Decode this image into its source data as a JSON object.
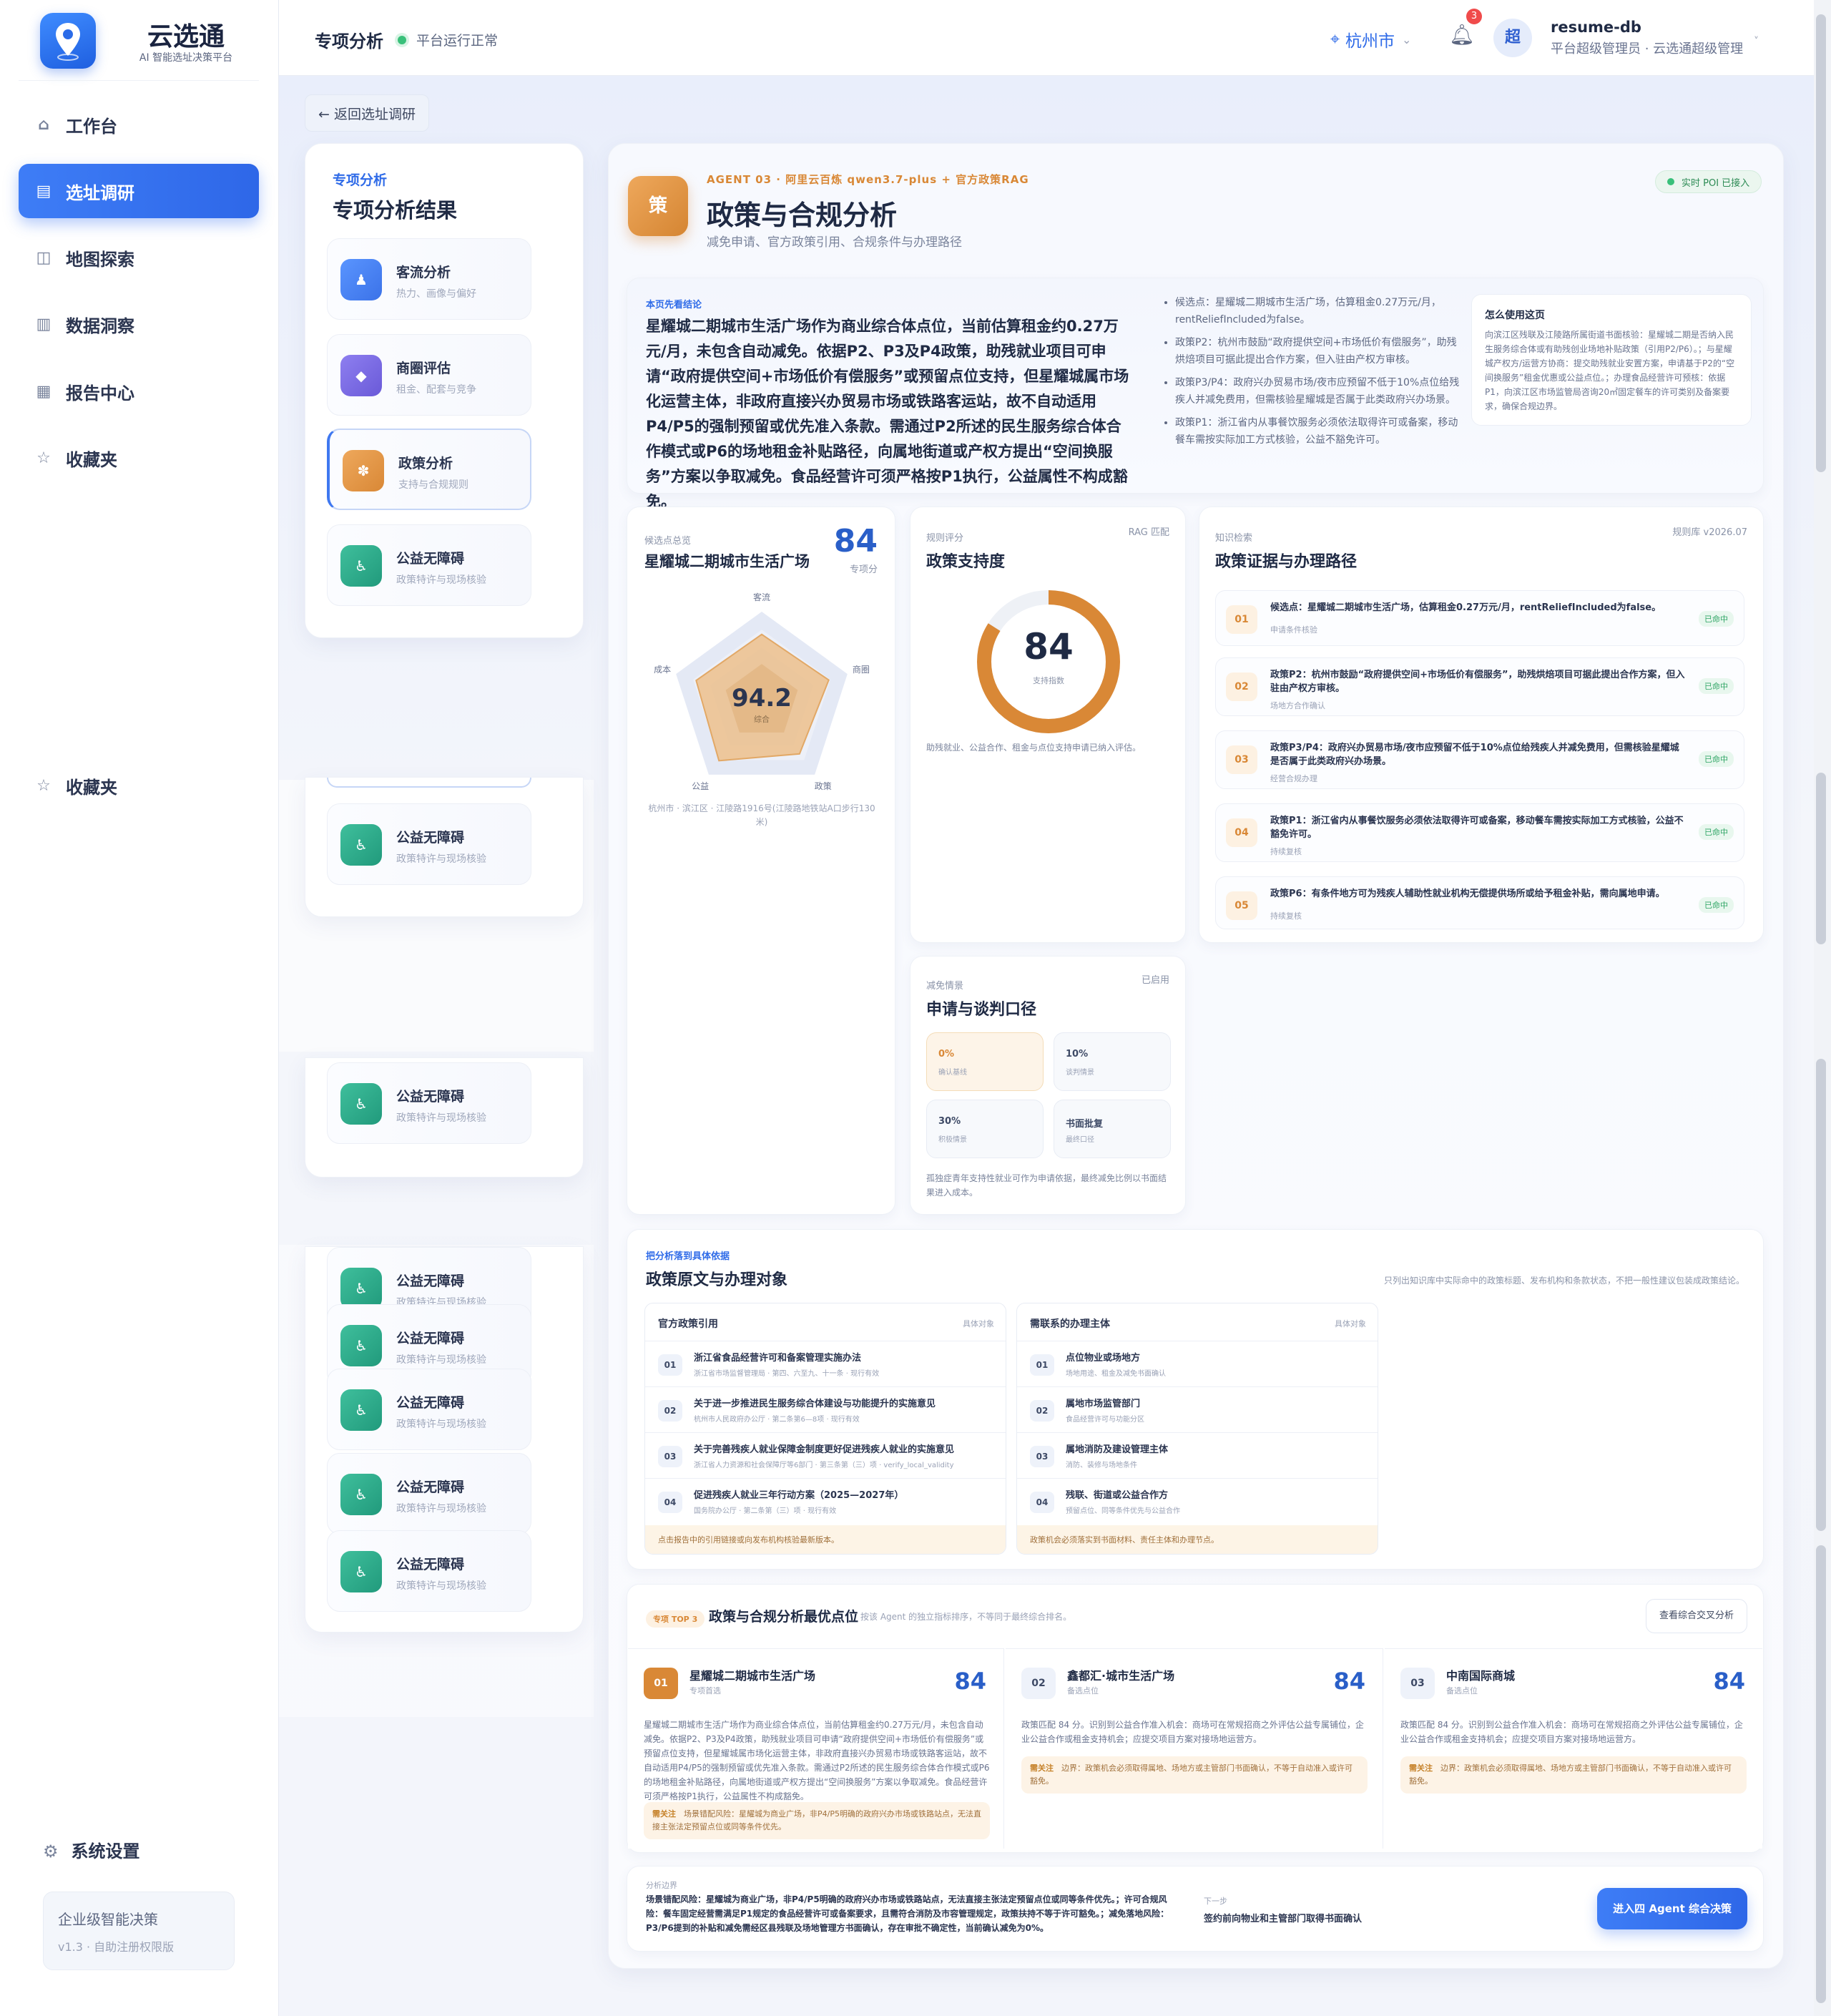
{
  "app": {
    "name": "云选通",
    "tagline": "AI 智能选址决策平台"
  },
  "nav": {
    "items": [
      {
        "label": "工作台",
        "icon": "home-icon"
      },
      {
        "label": "选址调研",
        "icon": "clipboard-icon"
      },
      {
        "label": "地图探索",
        "icon": "map-icon"
      },
      {
        "label": "数据洞察",
        "icon": "chart-icon"
      },
      {
        "label": "报告中心",
        "icon": "report-icon"
      },
      {
        "label": "收藏夹",
        "icon": "star-icon"
      }
    ],
    "dup_fav": "收藏夹",
    "settings": "系统设置",
    "enterprise_title": "企业级智能决策",
    "enterprise_sub": "v1.3 · 自助注册权限版"
  },
  "header": {
    "title": "专项分析",
    "status": "平台运行正常",
    "city": "杭州市",
    "bell_count": "3",
    "avatar": "超",
    "user": "resume-db",
    "role": "平台超级管理员 · 云选通超级管理"
  },
  "back_label": "← 返回选址调研",
  "left_panel": {
    "kicker": "专项分析",
    "title": "专项分析结果",
    "items": [
      {
        "name": "客流分析",
        "desc": "热力、画像与偏好",
        "glyph": "♟"
      },
      {
        "name": "商圈评估",
        "desc": "租金、配套与竞争",
        "glyph": "◆"
      },
      {
        "name": "政策分析",
        "desc": "支持与合规规则",
        "glyph": "✽"
      },
      {
        "name": "公益无障碍",
        "desc": "政策特许与现场核验",
        "glyph": "♿"
      }
    ],
    "ghost_item": {
      "name": "公益无障碍",
      "desc": "政策特许与现场核验"
    }
  },
  "agent": {
    "kicker": "AGENT 03 · 阿里云百炼 qwen3.7-plus + 官方政策RAG",
    "icon_char": "策",
    "title": "政策与合规分析",
    "subtitle": "减免申请、官方政策引用、合规条件与办理路径",
    "poi_badge": "实时 POI 已接入"
  },
  "summary": {
    "kicker": "本页先看结论",
    "text": "星耀城二期城市生活广场作为商业综合体点位，当前估算租金约0.27万元/月，未包含自动减免。依据P2、P3及P4政策，助残就业项目可申请“政府提供空间+市场低价有偿服务”或预留点位支持，但星耀城属市场化运营主体，非政府直接兴办贸易市场或铁路客运站，故不自动适用P4/P5的强制预留或优先准入条款。需通过P2所述的民生服务综合体合作模式或P6的场地租金补贴路径，向属地街道或产权方提出“空间换服务”方案以争取减免。食品经营许可须严格按P1执行，公益属性不构成豁免。",
    "bullets": [
      "候选点：星耀城二期城市生活广场，估算租金0.27万元/月，rentReliefIncluded为false。",
      "政策P2：杭州市鼓励“政府提供空间+市场低价有偿服务”，助残烘焙项目可据此提出合作方案，但入驻由产权方审核。",
      "政策P3/P4：政府兴办贸易市场/夜市应预留不低于10%点位给残疾人并减免费用，但需核验星耀城是否属于此类政府兴办场景。",
      "政策P1：浙江省内从事餐饮服务必须依法取得许可或备案，移动餐车需按实际加工方式核验，公益不豁免许可。"
    ],
    "howto_title": "怎么使用这页",
    "howto_text": "向滨江区残联及江陵路所属街道书面核验：星耀城二期是否纳入民生服务综合体或有助残创业场地补贴政策（引用P2/P6）。；与星耀城产权方/运营方协商：提交助残就业安置方案，申请基于P2的“空间换服务”租金优惠或公益点位。；办理食品经营许可预核：依据P1，向滨江区市场监管局咨询20㎡固定餐车的许可类别及备案要求，确保合规边界。"
  },
  "radar": {
    "kicker": "候选点总览",
    "score": "84",
    "score_label": "专项分",
    "title": "星耀城二期城市生活广场",
    "center_value": "94.2",
    "center_label": "综合",
    "axes": [
      "客流",
      "商圈",
      "政策",
      "公益",
      "成本"
    ],
    "address": "杭州市 · 滨江区 · 江陵路1916号(江陵路地铁站A口步行130米)"
  },
  "chart_data": {
    "type": "radar",
    "categories": [
      "客流",
      "商圈",
      "政策",
      "公益",
      "成本"
    ],
    "series": [
      {
        "values": [
          88,
          92,
          84,
          95,
          90
        ]
      }
    ],
    "center_value": 94.2
  },
  "support": {
    "kicker": "规则评分",
    "tag": "RAG 匹配",
    "title": "政策支持度",
    "score": "84",
    "score_label": "支持指数",
    "progress": 0.84,
    "note": "助残就业、公益合作、租金与点位支持申请已纳入评估。"
  },
  "evidence": {
    "kicker": "知识检索",
    "tag": "规则库 v2026.07",
    "title": "政策证据与办理路径",
    "rows": [
      {
        "num": "01",
        "text": "候选点：星耀城二期城市生活广场，估算租金0.27万元/月，rentReliefIncluded为false。",
        "sub": "申请条件核验",
        "tag": "已命中"
      },
      {
        "num": "02",
        "text": "政策P2：杭州市鼓励“政府提供空间+市场低价有偿服务”，助残烘焙项目可据此提出合作方案，但入驻由产权方审核。",
        "sub": "场地方合作确认",
        "tag": "已命中"
      },
      {
        "num": "03",
        "text": "政策P3/P4：政府兴办贸易市场/夜市应预留不低于10%点位给残疾人并减免费用，但需核验星耀城是否属于此类政府兴办场景。",
        "sub": "经营合规办理",
        "tag": "已命中"
      },
      {
        "num": "04",
        "text": "政策P1：浙江省内从事餐饮服务必须依法取得许可或备案，移动餐车需按实际加工方式核验，公益不豁免许可。",
        "sub": "持续复核",
        "tag": "已命中"
      },
      {
        "num": "05",
        "text": "政策P6：有条件地方可为残疾人辅助性就业机构无偿提供场所或给予租金补贴，需向属地申请。",
        "sub": "持续复核",
        "tag": "已命中"
      }
    ]
  },
  "relief": {
    "kicker": "减免情景",
    "tag": "已启用",
    "title": "申请与谈判口径",
    "cells": [
      {
        "v": "0%",
        "s": "确认基线"
      },
      {
        "v": "10%",
        "s": "谈判情景"
      },
      {
        "v": "30%",
        "s": "积极情景"
      },
      {
        "v": "书面批复",
        "s": "最终口径"
      }
    ],
    "note": "孤独症青年支持性就业可作为申请依据，最终减免比例以书面结果进入成本。"
  },
  "policy": {
    "kicker": "把分析落到具体依据",
    "title": "政策原文与办理对象",
    "note": "只列出知识库中实际命中的政策标题、发布机构和条款状态，不把一般性建议包装成政策结论。",
    "left_header": "官方政策引用",
    "left_tag": "具体对象",
    "left_rows": [
      {
        "n": "01",
        "a": "浙江省食品经营许可和备案管理实施办法",
        "b": "浙江省市场监督管理局 · 第四、六至九、十一条 · 现行有效"
      },
      {
        "n": "02",
        "a": "关于进一步推进民生服务综合体建设与功能提升的实施意见",
        "b": "杭州市人民政府办公厅 · 第二条第6—8项 · 现行有效"
      },
      {
        "n": "03",
        "a": "关于完善残疾人就业保障金制度更好促进残疾人就业的实施意见",
        "b": "浙江省人力资源和社会保障厅等6部门 · 第三条第（三）项 · verify_local_validity"
      },
      {
        "n": "04",
        "a": "促进残疾人就业三年行动方案（2025—2027年）",
        "b": "国务院办公厅 · 第二条第（三）项 · 现行有效"
      }
    ],
    "left_foot": "点击报告中的引用链接或向发布机构核验最新版本。",
    "right_header": "需联系的办理主体",
    "right_tag": "具体对象",
    "right_rows": [
      {
        "n": "01",
        "a": "点位物业或场地方",
        "b": "场地用途、租金及减免书面确认"
      },
      {
        "n": "02",
        "a": "属地市场监管部门",
        "b": "食品经营许可与功能分区"
      },
      {
        "n": "03",
        "a": "属地消防及建设管理主体",
        "b": "消防、装修与场地条件"
      },
      {
        "n": "04",
        "a": "残联、街道或公益合作方",
        "b": "预留点位、同等条件优先与公益合作"
      }
    ],
    "right_foot": "政策机会必须落实到书面材料、责任主体和办理节点。"
  },
  "top3": {
    "badge": "专项 TOP 3",
    "title": "政策与合规分析最优点位",
    "sub": "按该 Agent 的独立指标排序，不等同于最终综合排名。",
    "button": "查看综合交叉分析",
    "cards": [
      {
        "n": "01",
        "name": "星耀城二期城市生活广场",
        "state": "专项首选",
        "score": "84",
        "desc": "星耀城二期城市生活广场作为商业综合体点位，当前估算租金约0.27万元/月，未包含自动减免。依据P2、P3及P4政策，助残就业项目可申请“政府提供空间+市场低价有偿服务”或预留点位支持，但星耀城属市场化运营主体，非政府直接兴办贸易市场或铁路客运站，故不自动适用P4/P5的强制预留或优先准入条款。需通过P2所述的民生服务综合体合作模式或P6的场地租金补贴路径，向属地街道或产权方提出“空间换服务”方案以争取减免。食品经营许可须严格按P1执行，公益属性不构成豁免。",
        "warn_k": "需关注",
        "warn": "场景错配风险：星耀城为商业广场，非P4/P5明确的政府兴办市场或铁路站点，无法直接主张法定预留点位或同等条件优先。"
      },
      {
        "n": "02",
        "name": "鑫都汇·城市生活广场",
        "state": "备选点位",
        "score": "84",
        "desc": "政策匹配 84 分。识别到公益合作准入机会：商场可在常规招商之外评估公益专属铺位，企业公益合作或租金支持机会；应提交项目方案对接场地运营方。",
        "warn_k": "需关注",
        "warn": "边界：政策机会必须取得属地、场地方或主管部门书面确认，不等于自动准入或许可豁免。"
      },
      {
        "n": "03",
        "name": "中南国际商城",
        "state": "备选点位",
        "score": "84",
        "desc": "政策匹配 84 分。识别到公益合作准入机会：商场可在常规招商之外评估公益专属铺位，企业公益合作或租金支持机会；应提交项目方案对接场地运营方。",
        "warn_k": "需关注",
        "warn": "边界：政策机会必须取得属地、场地方或主管部门书面确认，不等于自动准入或许可豁免。"
      }
    ]
  },
  "footer": {
    "kicker": "分析边界",
    "text": "场景错配风险：星耀城为商业广场，非P4/P5明确的政府兴办市场或铁路站点，无法直接主张法定预留点位或同等条件优先。；许可合规风险：餐车固定经营需满足P1规定的食品经营许可或备案要求，且需符合消防及市容管理规定，政策扶持不等于许可豁免。；减免落地风险：P3/P6提到的补贴和减免需经区县残联及场地管理方书面确认，存在审批不确定性，当前确认减免为0%。",
    "next_k": "下一步",
    "next": "签约前向物业和主管部门取得书面确认",
    "button": "进入四 Agent 综合决策"
  },
  "colors": {
    "accent": "#2f6be8",
    "orange": "#d98836",
    "green": "#2fa565"
  }
}
